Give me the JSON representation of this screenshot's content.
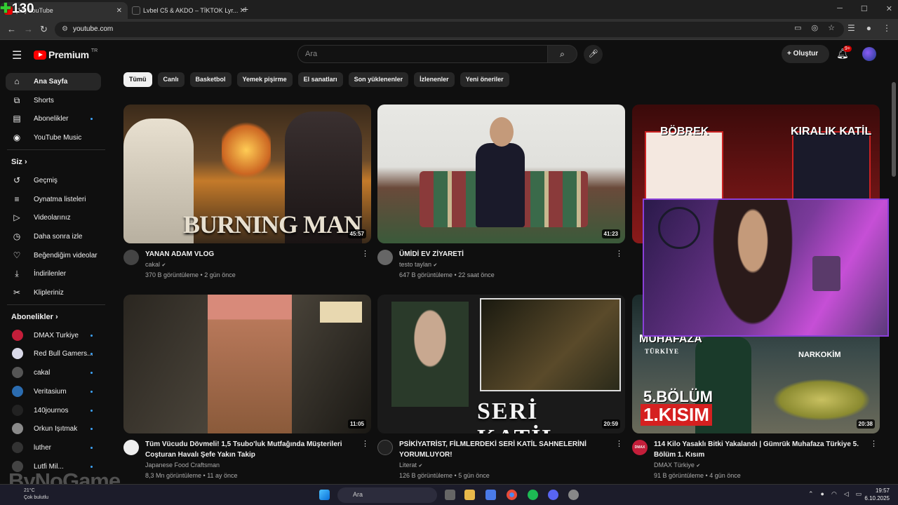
{
  "browser": {
    "counter": "130",
    "tabs": [
      {
        "label": "(14) YouTube",
        "active": true
      },
      {
        "label": "Lvbel C5 & AKDO – TİKTOK Lyr...",
        "active": false
      }
    ],
    "url": "youtube.com"
  },
  "header": {
    "logo": "Premium",
    "logo_region": "TR",
    "search_placeholder": "Ara",
    "create_label": "Oluştur",
    "notif_count": "9+"
  },
  "sidebar": {
    "main": [
      {
        "label": "Ana Sayfa",
        "icon": "home-icon",
        "selected": true
      },
      {
        "label": "Shorts",
        "icon": "shorts-icon"
      },
      {
        "label": "Abonelikler",
        "icon": "subscriptions-icon"
      },
      {
        "label": "YouTube Music",
        "icon": "music-icon"
      }
    ],
    "you_heading": "Siz",
    "you": [
      {
        "label": "Geçmiş",
        "icon": "history-icon"
      },
      {
        "label": "Oynatma listeleri",
        "icon": "playlist-icon"
      },
      {
        "label": "Videolarınız",
        "icon": "your-videos-icon"
      },
      {
        "label": "Daha sonra izle",
        "icon": "watch-later-icon"
      },
      {
        "label": "Beğendiğim videolar",
        "icon": "like-icon"
      },
      {
        "label": "İndirilenler",
        "icon": "download-icon"
      },
      {
        "label": "Klipleriniz",
        "icon": "clips-icon"
      }
    ],
    "subs_heading": "Abonelikler",
    "subs": [
      {
        "label": "DMAX Turkiye",
        "color": "#c41e3a"
      },
      {
        "label": "Red Bull Gamers...",
        "color": "#d9d9e8"
      },
      {
        "label": "cakal",
        "color": "#555555"
      },
      {
        "label": "Veritasium",
        "color": "#2b6cb0"
      },
      {
        "label": "140journos",
        "color": "#222222"
      },
      {
        "label": "Orkun Işıtmak",
        "color": "#8a8a8a"
      },
      {
        "label": "luther",
        "color": "#333333"
      },
      {
        "label": "Lutfi Mil...",
        "color": "#444444"
      }
    ]
  },
  "chips": [
    "Tümü",
    "Canlı",
    "Basketbol",
    "Yemek pişirme",
    "El sanatları",
    "Son yüklenenler",
    "İzlenenler",
    "Yeni öneriler"
  ],
  "videos": [
    {
      "title": "YANAN ADAM VLOG",
      "channel": "cakal",
      "stats": "370 B görüntüleme • 2 gün önce",
      "duration": "45:57",
      "thumb_text": "BURNING MAN"
    },
    {
      "title": "ÜMİDİ EV ZİYARETİ",
      "channel": "testo taylan",
      "stats": "647 B görüntüleme • 22 saat önce",
      "duration": "41:23"
    },
    {
      "title": "",
      "channel": "",
      "stats": "",
      "duration": "",
      "thumb_text_left": "BÖBREK",
      "thumb_text_right": "KIRALIK KATİL"
    },
    {
      "title": "Tüm Vücudu Dövmeli! 1,5 Tsubo'luk Mutfağında Müşterileri Coşturan Havalı Şefe Yakın Takip",
      "channel": "Japanese Food Craftsman",
      "stats": "8,3 Mn görüntüleme • 11 ay önce",
      "duration": "11:05"
    },
    {
      "title": "PSİKİYATRİST, FİLMLERDEKİ SERİ KATİL SAHNELERİNİ YORUMLUYOR!",
      "channel": "Literat",
      "stats": "126 B görüntüleme • 5 gün önce",
      "duration": "20:59",
      "thumb_text": "SERİ KATİL"
    },
    {
      "title": "114 Kilo Yasaklı Bitki Yakalandı | Gümrük Muhafaza Türkiye 5. Bölüm 1. Kısım",
      "channel": "DMAX Türkiye",
      "stats": "91 B görüntüleme • 4 gün önce",
      "duration": "20:38",
      "thumb_text": "5.BÖLÜM",
      "thumb_text2": "1.KISIM",
      "thumb_top": "MUHAFAZA",
      "thumb_sub": "TÜRKİYE",
      "thumb_badge": "NARKOKİM",
      "avatar_text": "DMAX"
    }
  ],
  "taskbar": {
    "weather_temp": "21°C",
    "weather_text": "Çok bulutlu",
    "search": "Ara",
    "time": "19:57",
    "date": "6.10.2025"
  },
  "watermark": "ByNoGame"
}
